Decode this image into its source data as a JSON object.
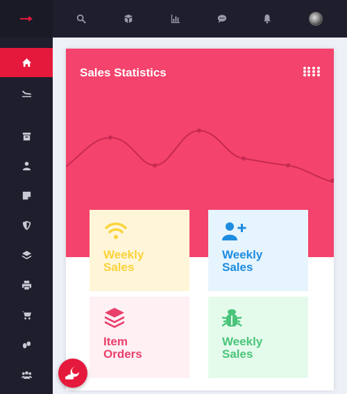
{
  "colors": {
    "accent": "#e5193c",
    "header": "#f4436c",
    "sidebar": "#1e1e2d"
  },
  "sidebar": {
    "toggle_icon": "arrow-right-icon",
    "items": [
      {
        "icon": "home-icon",
        "active": true
      },
      {
        "icon": "plane-icon",
        "active": false
      },
      {
        "icon": "archive-icon",
        "active": false
      },
      {
        "icon": "user-icon",
        "active": false
      },
      {
        "icon": "note-icon",
        "active": false
      },
      {
        "icon": "shield-icon",
        "active": false
      },
      {
        "icon": "layers-icon",
        "active": false
      },
      {
        "icon": "printer-icon",
        "active": false
      },
      {
        "icon": "cart-icon",
        "active": false
      },
      {
        "icon": "footsteps-icon",
        "active": false
      },
      {
        "icon": "users-icon",
        "active": false
      }
    ]
  },
  "topbar": {
    "icons": [
      "search-icon",
      "box-icon",
      "chart-icon",
      "chat-icon",
      "bell-icon"
    ],
    "avatar": "avatar"
  },
  "card": {
    "title": "Sales Statistics",
    "menu_icon": "dots-grid-icon",
    "tiles": [
      {
        "label": "Weekly\nSales",
        "icon": "wifi-icon",
        "color": "#fbd33a",
        "bg": "#fff6d9"
      },
      {
        "label": "Weekly\nSales",
        "icon": "user-plus-icon",
        "color": "#1e8ce0",
        "bg": "#e6f4fe"
      },
      {
        "label": "Item\nOrders",
        "icon": "layers-icon",
        "color": "#e8406b",
        "bg": "#fff0f4"
      },
      {
        "label": "Weekly\nSales",
        "icon": "bug-icon",
        "color": "#4ac47a",
        "bg": "#e4fbec"
      }
    ]
  },
  "fab": {
    "icon": "cloud-moon-icon"
  }
}
